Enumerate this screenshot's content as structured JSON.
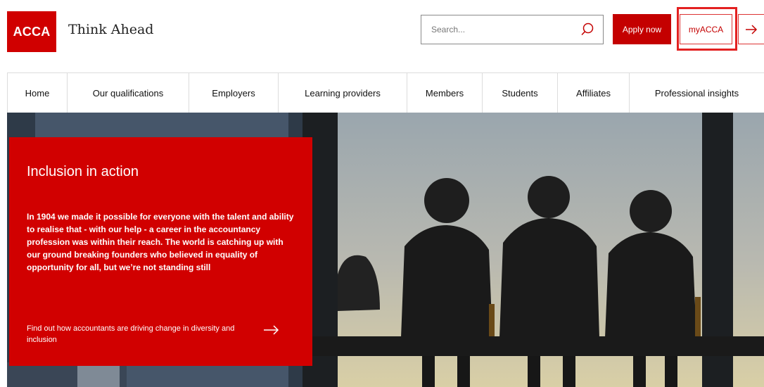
{
  "header": {
    "logo_text": "ACCA",
    "tagline": "Think Ahead",
    "search": {
      "placeholder": "Search...",
      "value": ""
    },
    "apply_label": "Apply now",
    "myacca_label": "myACCA",
    "brand_color": "#d00000",
    "icons": {
      "search": "search-icon",
      "login": "arrow-right-icon"
    }
  },
  "nav": {
    "items": [
      {
        "label": "Home"
      },
      {
        "label": "Our qualifications"
      },
      {
        "label": "Employers"
      },
      {
        "label": "Learning providers"
      },
      {
        "label": "Members"
      },
      {
        "label": "Students"
      },
      {
        "label": "Affiliates"
      },
      {
        "label": "Professional insights"
      }
    ]
  },
  "hero": {
    "title": "Inclusion in action",
    "body": "In 1904 we made it possible for everyone with the talent and ability to realise that - with our help - a career in the accountancy profession was within their reach. The world is catching up with our ground breaking founders who believed in equality of opportunity for all, but we’re not standing still",
    "link_text": "Find out how accountants are driving change in diversity and inclusion",
    "card_color": "#d10000"
  }
}
